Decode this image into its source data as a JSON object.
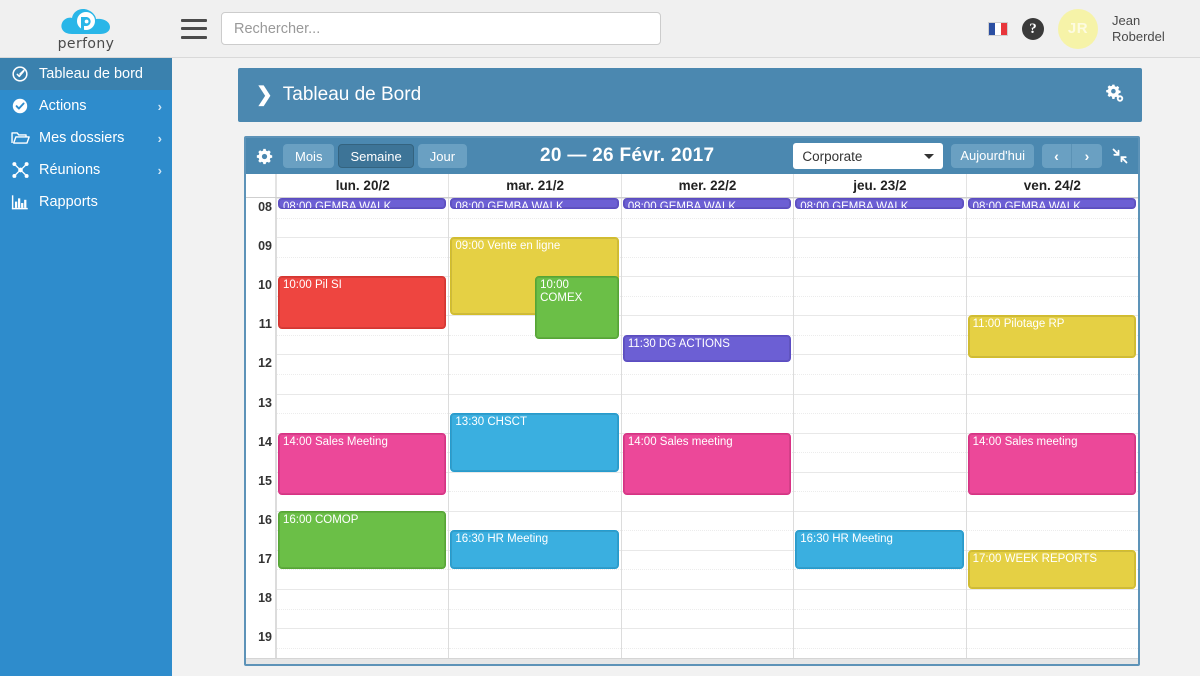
{
  "brand": {
    "name": "perfony",
    "logo_icon": "cloud-p-logo"
  },
  "topbar": {
    "menu_icon": "hamburger-icon",
    "search": {
      "placeholder": "Rechercher...",
      "value": "",
      "icon": "search-input"
    },
    "language_flag": "fr-flag-icon",
    "help_icon": "help-question-icon",
    "avatar_initials": "JR",
    "user_name_line1": "Jean",
    "user_name_line2": "Roberdel"
  },
  "sidebar": {
    "items": [
      {
        "label": "Tableau de bord",
        "icon": "dashboard-gauge-icon",
        "active": true,
        "has_arrow": false
      },
      {
        "label": "Actions",
        "icon": "check-circle-icon",
        "active": false,
        "has_arrow": true
      },
      {
        "label": "Mes dossiers",
        "icon": "folder-open-icon",
        "active": false,
        "has_arrow": true
      },
      {
        "label": "Réunions",
        "icon": "network-nodes-icon",
        "active": false,
        "has_arrow": true
      },
      {
        "label": "Rapports",
        "icon": "bar-chart-icon",
        "active": false,
        "has_arrow": false
      }
    ],
    "arrow_glyph": "›"
  },
  "page_header": {
    "chevron": "❯",
    "title": "Tableau de Bord",
    "settings_icon": "gears-icon"
  },
  "calendar": {
    "settings_icon": "gear-icon",
    "views": [
      {
        "label": "Mois",
        "active": false
      },
      {
        "label": "Semaine",
        "active": true
      },
      {
        "label": "Jour",
        "active": false
      }
    ],
    "range_title": "20 — 26 Févr. 2017",
    "selected_scope": "Corporate",
    "today_label": "Aujourd'hui",
    "prev_label": "‹",
    "next_label": "›",
    "collapse_icon": "collapse-arrows-icon",
    "day_headers": [
      "lun. 20/2",
      "mar. 21/2",
      "mer. 22/2",
      "jeu. 23/2",
      "ven. 24/2"
    ],
    "hours": [
      "08",
      "09",
      "10",
      "11",
      "12",
      "13",
      "14",
      "15",
      "16",
      "17",
      "18",
      "19"
    ],
    "events": [
      {
        "day": 0,
        "label": "08:00 GEMBA WALK",
        "start": 8.0,
        "end": 8.25,
        "color": "purple",
        "offset": 0
      },
      {
        "day": 1,
        "label": "08:00 GEMBA WALK",
        "start": 8.0,
        "end": 8.25,
        "color": "purple",
        "offset": 0
      },
      {
        "day": 2,
        "label": "08:00 GEMBA WALK",
        "start": 8.0,
        "end": 8.25,
        "color": "purple",
        "offset": 0
      },
      {
        "day": 3,
        "label": "08:00 GEMBA WALK",
        "start": 8.0,
        "end": 8.25,
        "color": "purple",
        "offset": 0
      },
      {
        "day": 4,
        "label": "08:00 GEMBA WALK",
        "start": 8.0,
        "end": 8.25,
        "color": "purple",
        "offset": 0
      },
      {
        "day": 1,
        "label": "09:00 Vente en ligne",
        "start": 9.0,
        "end": 11.0,
        "color": "yellow",
        "offset": 0
      },
      {
        "day": 1,
        "label": "10:00 COMEX",
        "start": 10.0,
        "end": 11.6,
        "color": "green",
        "offset": 50
      },
      {
        "day": 0,
        "label": "10:00 Pil SI",
        "start": 10.0,
        "end": 11.35,
        "color": "red",
        "offset": 0
      },
      {
        "day": 2,
        "label": "11:30 DG ACTIONS",
        "start": 11.5,
        "end": 12.2,
        "color": "purple",
        "offset": 0
      },
      {
        "day": 4,
        "label": "11:00 Pilotage RP",
        "start": 11.0,
        "end": 12.1,
        "color": "yellow",
        "offset": 0
      },
      {
        "day": 1,
        "label": "13:30 CHSCT",
        "start": 13.5,
        "end": 15.0,
        "color": "blue",
        "offset": 0
      },
      {
        "day": 0,
        "label": "14:00 Sales Meeting",
        "start": 14.0,
        "end": 15.6,
        "color": "pink",
        "offset": 0
      },
      {
        "day": 2,
        "label": "14:00 Sales meeting",
        "start": 14.0,
        "end": 15.6,
        "color": "pink",
        "offset": 0
      },
      {
        "day": 4,
        "label": "14:00 Sales meeting",
        "start": 14.0,
        "end": 15.6,
        "color": "pink",
        "offset": 0
      },
      {
        "day": 0,
        "label": "16:00 COMOP",
        "start": 16.0,
        "end": 17.5,
        "color": "green",
        "offset": 0
      },
      {
        "day": 1,
        "label": "16:30 HR Meeting",
        "start": 16.5,
        "end": 17.5,
        "color": "blue",
        "offset": 0
      },
      {
        "day": 3,
        "label": "16:30 HR Meeting",
        "start": 16.5,
        "end": 17.5,
        "color": "blue",
        "offset": 0
      },
      {
        "day": 4,
        "label": "17:00 WEEK REPORTS",
        "start": 17.0,
        "end": 18.0,
        "color": "yellow",
        "offset": 0
      }
    ]
  },
  "colors": {
    "brand_blue": "#2e8ccc",
    "header_blue": "#4b88b0",
    "active_sidebar": "#3a81ae",
    "event_purple": "#6c5fd4",
    "event_yellow": "#e5d044",
    "event_green": "#6bbf47",
    "event_red": "#ee4540",
    "event_blue": "#3aafe0",
    "event_pink": "#ec4899",
    "avatar_yellow": "#f6f3a8"
  }
}
